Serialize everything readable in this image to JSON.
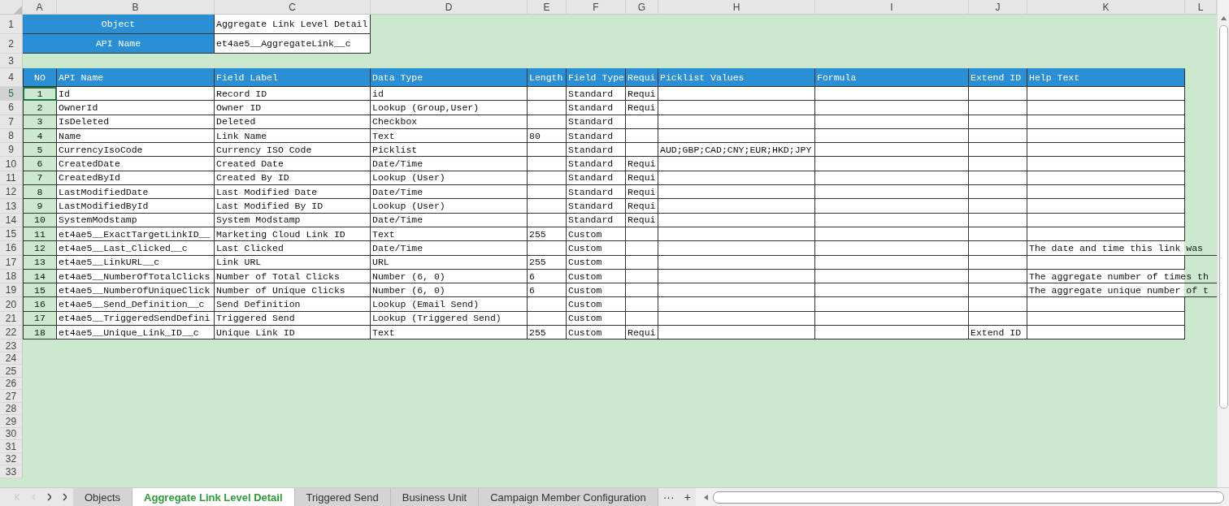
{
  "column_headers": [
    "A",
    "B",
    "C",
    "D",
    "E",
    "F",
    "G",
    "H",
    "I",
    "J",
    "K",
    "L"
  ],
  "meta": [
    {
      "label": "Object",
      "value": "Aggregate Link Level Detail"
    },
    {
      "label": "API Name",
      "value": "et4ae5__AggregateLink__c"
    }
  ],
  "table": {
    "columns": [
      "NO",
      "API Name",
      "Field Label",
      "Data Type",
      "Length",
      "Field Type",
      "Requi",
      "Picklist Values",
      "Formula",
      "Extend ID",
      "Help Text"
    ],
    "rows": [
      {
        "no": "1",
        "api_name": "Id",
        "field_label": "Record ID",
        "data_type": "id",
        "field_type": "Standard",
        "required": "Requi",
        "selected": true
      },
      {
        "no": "2",
        "api_name": "OwnerId",
        "field_label": "Owner ID",
        "data_type": "Lookup (Group,User)",
        "field_type": "Standard",
        "required": "Requi",
        "selected": false
      },
      {
        "no": "3",
        "api_name": "IsDeleted",
        "field_label": "Deleted",
        "data_type": "Checkbox",
        "field_type": "Standard",
        "selected": false
      },
      {
        "no": "4",
        "api_name": "Name",
        "field_label": "Link Name",
        "data_type": "Text",
        "length": "80",
        "field_type": "Standard",
        "selected": false
      },
      {
        "no": "5",
        "api_name": "CurrencyIsoCode",
        "field_label": "Currency ISO Code",
        "data_type": "Picklist",
        "field_type": "Standard",
        "picklist_values": "AUD;GBP;CAD;CNY;EUR;HKD;JPY",
        "selected": false
      },
      {
        "no": "6",
        "api_name": "CreatedDate",
        "field_label": "Created Date",
        "data_type": "Date/Time",
        "field_type": "Standard",
        "required": "Requi",
        "selected": false
      },
      {
        "no": "7",
        "api_name": "CreatedById",
        "field_label": "Created By ID",
        "data_type": "Lookup (User)",
        "field_type": "Standard",
        "required": "Requi",
        "selected": false
      },
      {
        "no": "8",
        "api_name": "LastModifiedDate",
        "field_label": "Last Modified Date",
        "data_type": "Date/Time",
        "field_type": "Standard",
        "required": "Requi",
        "selected": false
      },
      {
        "no": "9",
        "api_name": "LastModifiedById",
        "field_label": "Last Modified By ID",
        "data_type": "Lookup (User)",
        "field_type": "Standard",
        "required": "Requi",
        "selected": false
      },
      {
        "no": "10",
        "api_name": "SystemModstamp",
        "field_label": "System Modstamp",
        "data_type": "Date/Time",
        "field_type": "Standard",
        "required": "Requi",
        "selected": false
      },
      {
        "no": "11",
        "api_name": "et4ae5__ExactTargetLinkID__",
        "field_label": "Marketing Cloud Link ID",
        "data_type": "Text",
        "length": "255",
        "field_type": "Custom",
        "selected": false
      },
      {
        "no": "12",
        "api_name": "et4ae5__Last_Clicked__c",
        "field_label": "Last Clicked",
        "data_type": "Date/Time",
        "field_type": "Custom",
        "help_text": "The date and time this link was",
        "selected": false
      },
      {
        "no": "13",
        "api_name": "et4ae5__LinkURL__c",
        "field_label": "Link URL",
        "data_type": "URL",
        "length": "255",
        "field_type": "Custom",
        "selected": false
      },
      {
        "no": "14",
        "api_name": "et4ae5__NumberOfTotalClicks",
        "field_label": "Number of Total Clicks",
        "data_type": "Number (6, 0)",
        "length": "6",
        "field_type": "Custom",
        "help_text": "The aggregate number of times th",
        "selected": false
      },
      {
        "no": "15",
        "api_name": "et4ae5__NumberOfUniqueClick",
        "field_label": "Number of Unique Clicks",
        "data_type": "Number (6, 0)",
        "length": "6",
        "field_type": "Custom",
        "help_text": "The aggregate unique number of t",
        "selected": false
      },
      {
        "no": "16",
        "api_name": "et4ae5__Send_Definition__c",
        "field_label": "Send Definition",
        "data_type": "Lookup (Email Send)",
        "field_type": "Custom",
        "selected": false
      },
      {
        "no": "17",
        "api_name": "et4ae5__TriggeredSendDefini",
        "field_label": "Triggered Send",
        "data_type": "Lookup (Triggered Send)",
        "field_type": "Custom",
        "selected": false
      },
      {
        "no": "18",
        "api_name": "et4ae5__Unique_Link_ID__c",
        "field_label": "Unique Link ID",
        "data_type": "Text",
        "length": "255",
        "field_type": "Custom",
        "required": "Requi",
        "extend_id": "Extend ID",
        "selected": false
      }
    ]
  },
  "row_numbers": [
    "1",
    "2",
    "3",
    "4",
    "5",
    "6",
    "7",
    "8",
    "9",
    "10",
    "11",
    "12",
    "13",
    "14",
    "15",
    "16",
    "17",
    "18",
    "19",
    "20",
    "21",
    "22",
    "23",
    "24",
    "25",
    "26",
    "27",
    "28",
    "29",
    "30",
    "31",
    "32",
    "33"
  ],
  "sheet_tabs": [
    {
      "label": "Objects",
      "selected": false
    },
    {
      "label": "Aggregate Link Level Detail",
      "selected": true
    },
    {
      "label": "Triggered Send",
      "selected": false
    },
    {
      "label": "Business Unit",
      "selected": false
    },
    {
      "label": "Campaign Member Configuration",
      "selected": false
    }
  ],
  "more_tabs": "···",
  "add_tab": "+"
}
